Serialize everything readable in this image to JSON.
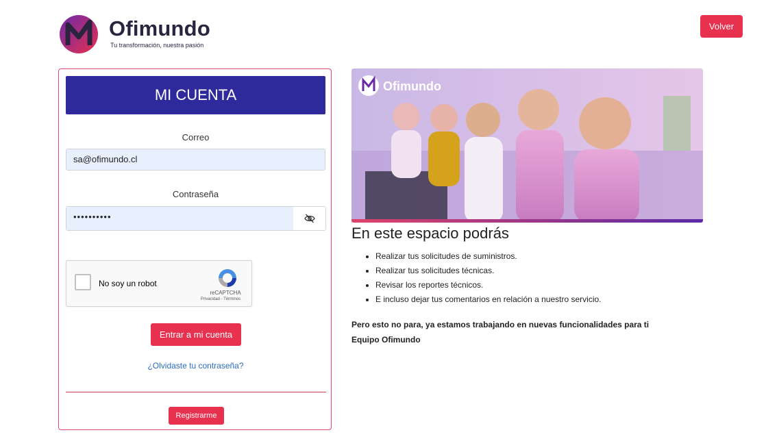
{
  "header": {
    "brand_name": "Ofimundo",
    "tagline": "Tu transformación, nuestra pasión",
    "back_button": "Volver"
  },
  "login": {
    "title": "MI CUENTA",
    "email_label": "Correo",
    "email_value": "sa@ofimundo.cl",
    "password_label": "Contraseña",
    "password_masked": "••••••••••",
    "recaptcha": {
      "label": "No soy un robot",
      "brand": "reCAPTCHA",
      "terms": "Privacidad - Términos"
    },
    "submit_button": "Entrar a mi cuenta",
    "forgot_link": "¿Olvidaste tu contraseña?",
    "register_button": "Registrarme"
  },
  "banner": {
    "brand": "Ofimundo"
  },
  "info": {
    "title": "En este espacio podrás",
    "items": [
      "Realizar tus solicitudes de suministros.",
      "Realizar tus solicitudes técnicas.",
      "Revisar los reportes técnicos.",
      "E incluso dejar tus comentarios en relación a nuestro servicio."
    ],
    "note_line1": "Pero esto no para, ya estamos trabajando en nuevas funcionalidades para ti",
    "note_line2": "Equipo Ofimundo"
  },
  "colors": {
    "accent": "#e8304f",
    "header_blue": "#2f2a9c",
    "link": "#2a6cc1"
  }
}
